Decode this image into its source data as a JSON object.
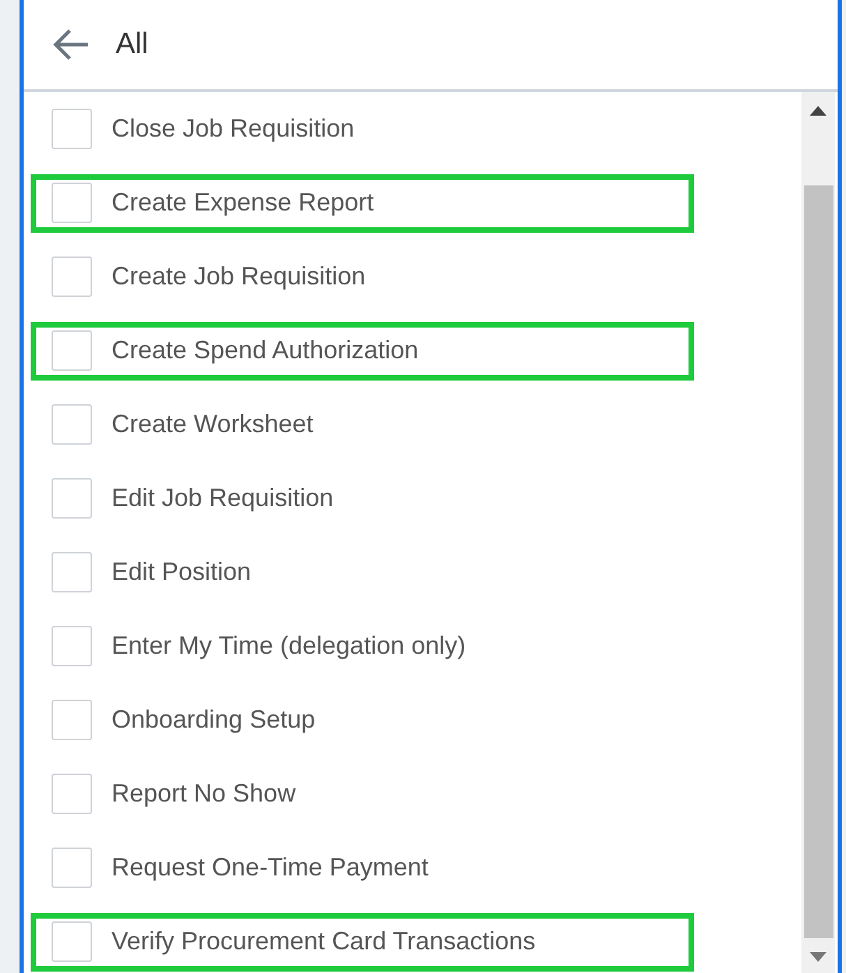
{
  "header": {
    "title": "All"
  },
  "items": [
    {
      "label": "Close Job Requisition",
      "checked": false,
      "highlighted": false
    },
    {
      "label": "Create Expense Report",
      "checked": false,
      "highlighted": true
    },
    {
      "label": "Create Job Requisition",
      "checked": false,
      "highlighted": false
    },
    {
      "label": "Create Spend Authorization",
      "checked": false,
      "highlighted": true
    },
    {
      "label": "Create Worksheet",
      "checked": false,
      "highlighted": false
    },
    {
      "label": "Edit Job Requisition",
      "checked": false,
      "highlighted": false
    },
    {
      "label": "Edit Position",
      "checked": false,
      "highlighted": false
    },
    {
      "label": "Enter My Time (delegation only)",
      "checked": false,
      "highlighted": false
    },
    {
      "label": "Onboarding Setup",
      "checked": false,
      "highlighted": false
    },
    {
      "label": "Report No Show",
      "checked": false,
      "highlighted": false
    },
    {
      "label": "Request One-Time Payment",
      "checked": false,
      "highlighted": false
    },
    {
      "label": "Verify Procurement Card Transactions",
      "checked": false,
      "highlighted": true
    }
  ]
}
